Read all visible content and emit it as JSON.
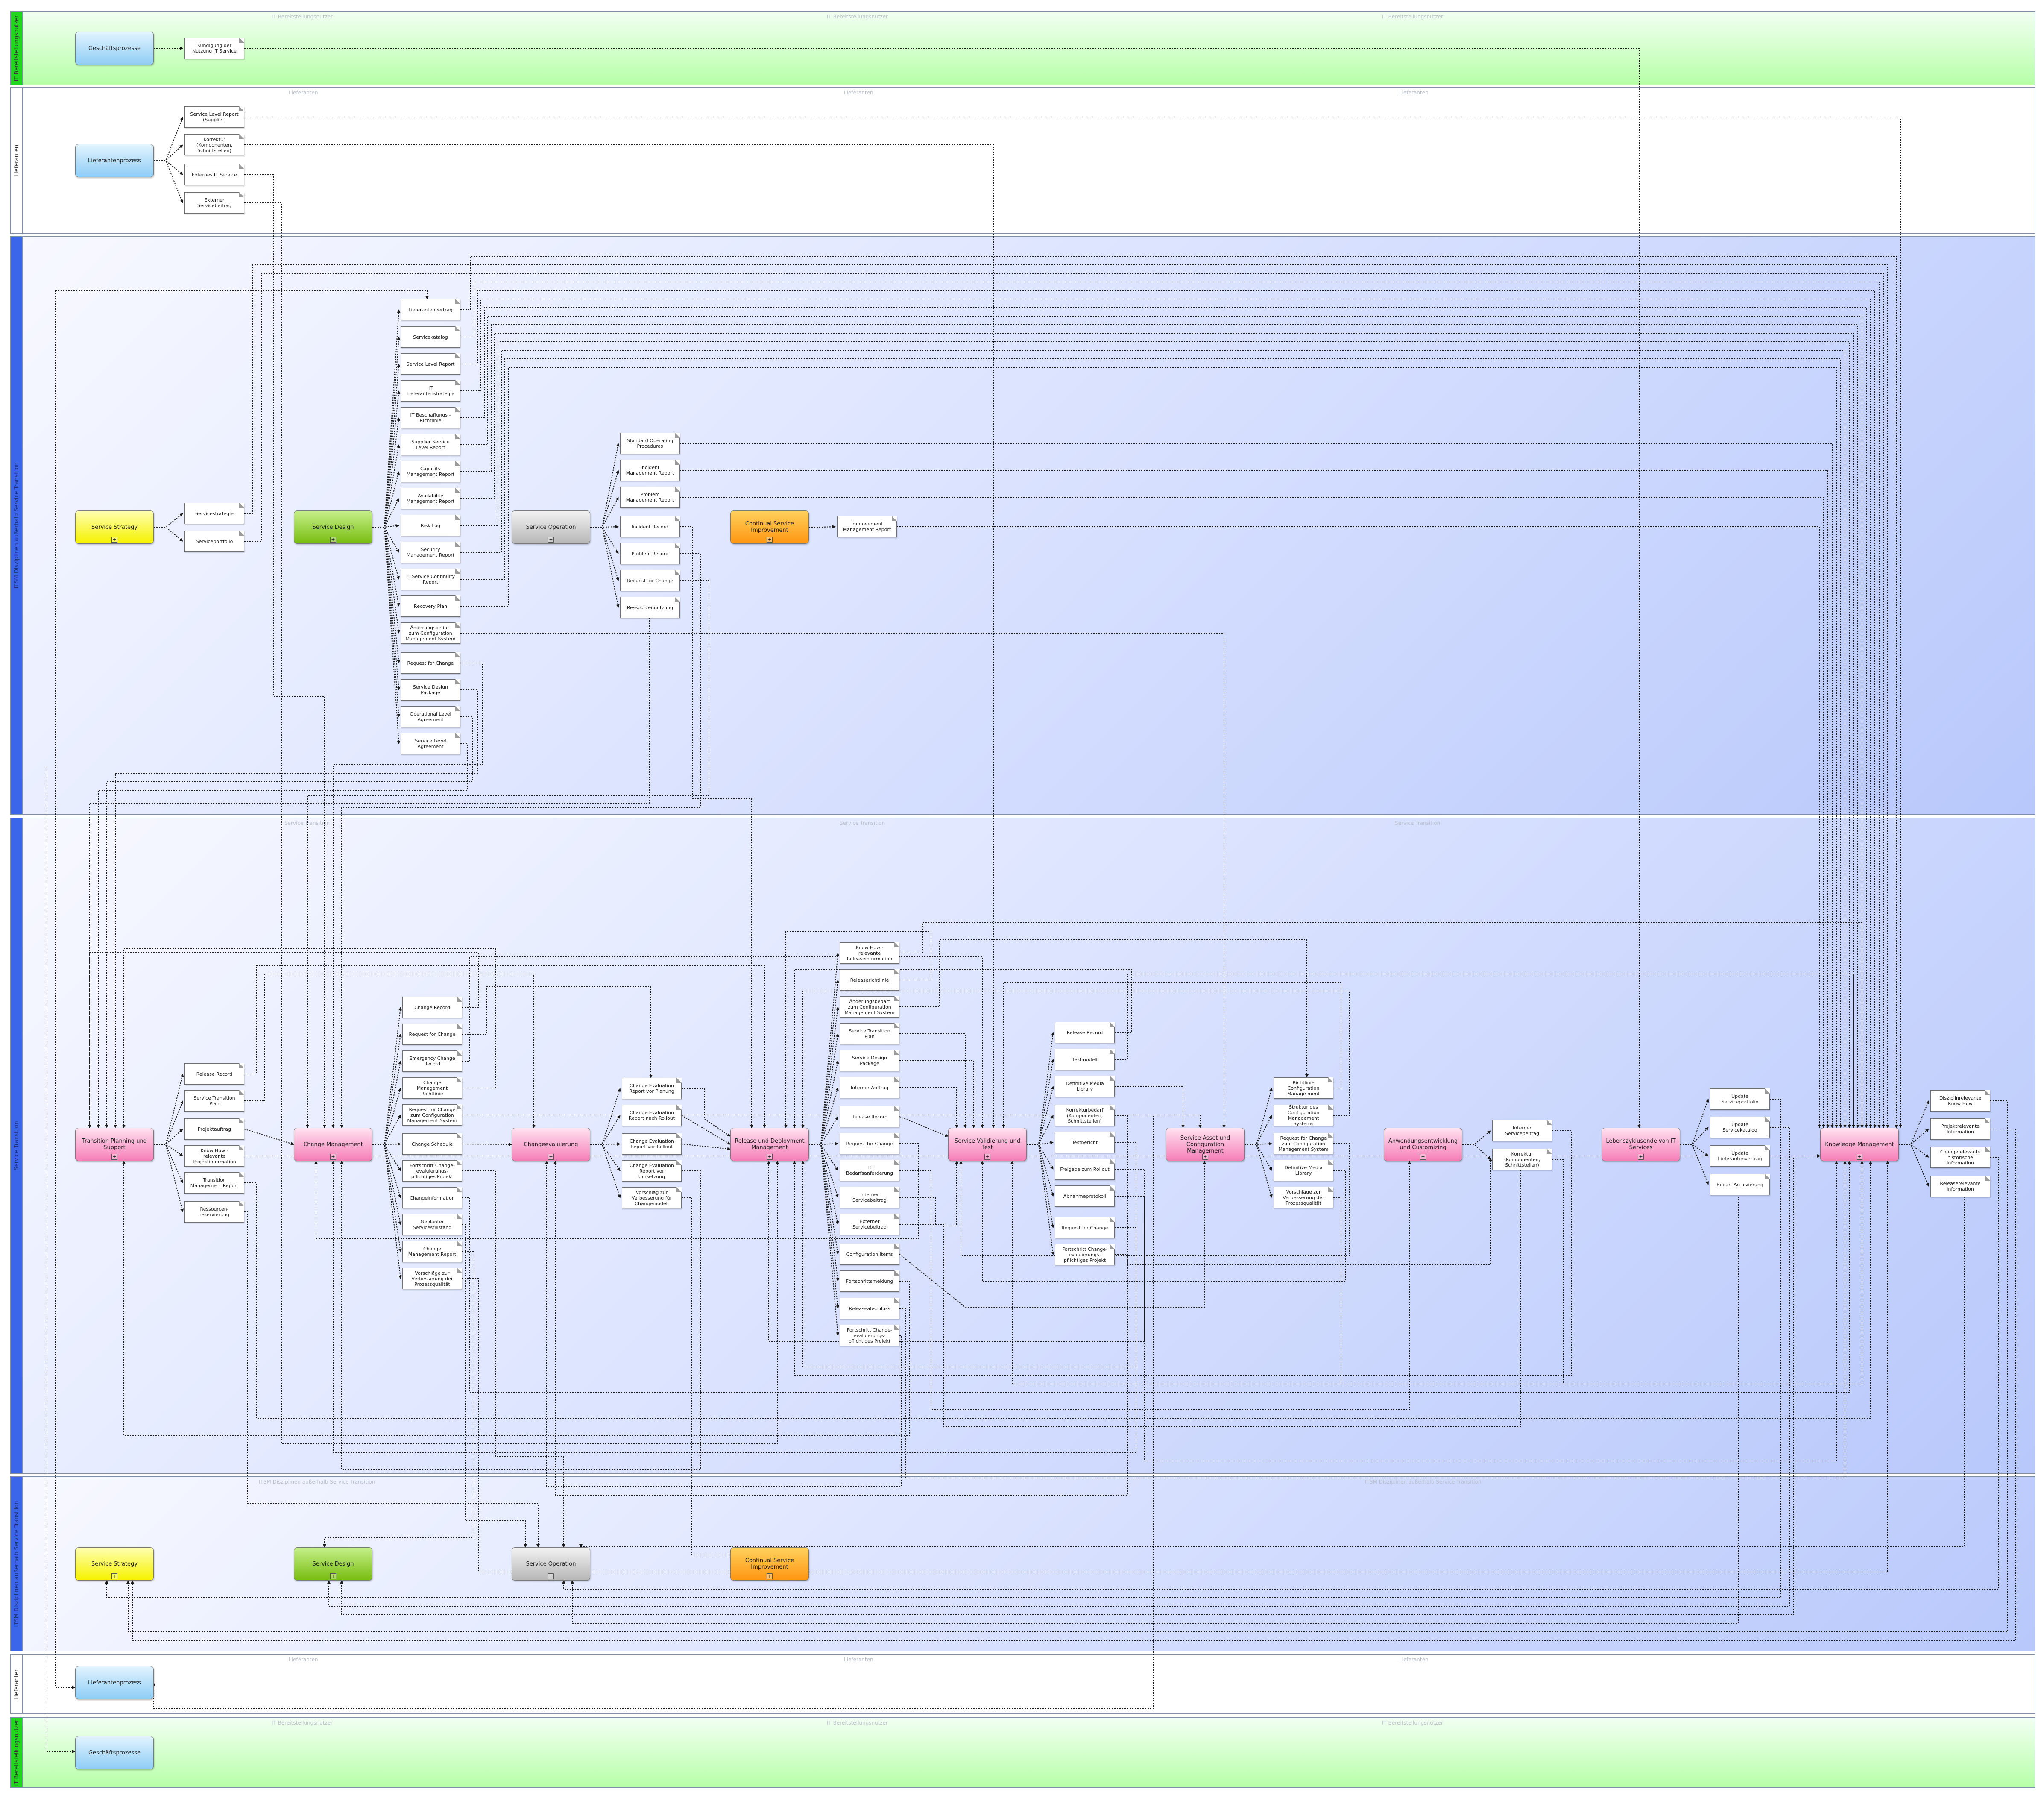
{
  "lanes": {
    "top_green": "IT Bereitstellungsnutzer",
    "supplier_top": "Lieferanten",
    "itsm_top": "ITSM Disziplinen außerhalb Service Transition",
    "service_transition": "Service Transition",
    "itsm_bottom": "ITSM Disziplinen außerhalb Service Transition",
    "supplier_bottom": "Lieferanten",
    "bottom_green": "IT Bereitstellungsnutzer"
  },
  "processes": {
    "geschaeftsprozesse_top": "Geschäftsprozesse",
    "lieferantenprozess_top": "Lieferantenprozess",
    "service_strategy_top": "Service Strategy",
    "service_design_top": "Service Design",
    "service_operation_top": "Service Operation",
    "csi_top": "Continual Service Improvement",
    "transition_planning": "Transition Planning und Support",
    "change_management": "Change Management",
    "changeevaluierung": "Changeevaluierung",
    "release_deployment": "Release und Deployment Management",
    "service_validierung": "Service Validierung und Test",
    "service_asset": "Service Asset und Configuration Management",
    "anwendungsentwicklung": "Anwendungsentwicklung und Customizing",
    "lebenszyklus": "Lebenszyklusende von IT Services",
    "knowledge_management": "Knowledge Management",
    "service_strategy_bottom": "Service Strategy",
    "service_design_bottom": "Service Design",
    "service_operation_bottom": "Service Operation",
    "csi_bottom": "Continual Service Improvement",
    "lieferantenprozess_bottom": "Lieferantenprozess",
    "geschaeftsprozesse_bottom": "Geschäftsprozesse"
  },
  "docs": {
    "kuendigung": "Kündigung der Nutzung IT Service",
    "sl_report_supplier": "Service Level Report (Supplier)",
    "korrektur_supplier": "Korrektur (Komponenten, Schnittstellen)",
    "externer_it_service": "Externes IT Service",
    "externer_servicebeitrag": "Externer Servicebeitrag",
    "servicestrategie": "Servicestrategie",
    "serviceportfolio": "Serviceportfolio",
    "lieferantenvertrag": "Lieferantenvertrag",
    "servicekatalog": "Servicekatalog",
    "service_level_report": "Service Level Report",
    "it_lieferantenstrategie": "IT Lieferantenstrategie",
    "it_beschaffungsrichtlinie": "IT Beschaffungs - Richtlinie",
    "supplier_sl_report": "Supplier Service Level Report",
    "capacity_report": "Capacity Management Report",
    "availability_report": "Availability Management Report",
    "risk_log": "Risk Log",
    "security_report": "Security Management Report",
    "it_service_continuity": "IT Service Continuity Report",
    "recovery_plan": "Recovery Plan",
    "aenderungsbedarf_cms_sd": "Änderungsbedarf zum Configuration Management System",
    "rfc_sd": "Request for Change",
    "sdp_sd": "Service Design Package",
    "ola": "Operational Level Agreement",
    "sla": "Service Level Agreement",
    "sop": "Standard Operating Procedures",
    "incident_mgmt_report": "Incident Management Report",
    "problem_mgmt_report": "Problem Management Report",
    "incident_record": "Incident Record",
    "problem_record": "Problem Record",
    "rfc_so": "Request for Change",
    "ressourcennutzung": "Ressourcennutzung",
    "improvement_report": "Improvement Management Report",
    "release_record_tp": "Release Record",
    "stp_tp": "Service Transition Plan",
    "projektauftrag": "Projektauftrag",
    "know_how_tp": "Know How - relevante Projektinformation",
    "transition_mgmt_report": "Transition Management Report",
    "ressourcenreservierung": "Ressourcen-reservierung",
    "change_record": "Change Record",
    "rfc_cm": "Request for Change",
    "emergency_change": "Emergency Change Record",
    "cm_richtlinie": "Change Management Richtlinie",
    "rfc_cms": "Request for Change zum Configuration Management System",
    "change_schedule": "Change Schedule",
    "fortschritt_change_cm": "Fortschritt Change-evaluierungs-pflichtiges Projekt",
    "changeinformation": "Changeinformation",
    "geplanter_servicestillstand": "Geplanter Servicestillstand",
    "cm_report": "Change Management Report",
    "vorschlaege_cm": "Vorschläge zur Verbesserung der Prozessqualität",
    "cer_planung": "Change Evaluation Report vor Planung",
    "cer_nach_rollout": "Change Evaluation Report nach Rollout",
    "cer_vor_rollout": "Change Evaluation Report vor Rollout",
    "cer_vor_umsetzung": "Change Evaluation Report vor Umsetzung",
    "vorschlag_verbesserung_changemodell": "Vorschlag zur Verbesserung für Changemodell",
    "know_how_release": "Know How - relevante Releaseinformation",
    "releaserichtlinie": "Releaserichtlinie",
    "aenderungsbedarf_cms_rd": "Änderungsbedarf zum Configuration Management System",
    "stp_rd": "Service Transition Plan",
    "sdp_rd": "Service Design Package",
    "interner_auftrag": "Interner Auftrag",
    "release_record_rd": "Release Record",
    "rfc_rd": "Request for Change",
    "it_bedarfsanforderung": "IT Bedarfsanforderung",
    "interner_servicebeitrag_rd": "Interner Servicebeitrag",
    "externer_servicebeitrag_rd": "Externer Servicebeitrag",
    "configuration_items": "Configuration Items",
    "fortschrittsmeldung": "Fortschrittsmeldung",
    "releaseabschluss": "Releaseabschluss",
    "fortschritt_change_rd": "Fortschritt Change-evaluierungs-pflichtiges Projekt",
    "release_record_sv": "Release Record",
    "testmodell": "Testmodell",
    "dml_sv": "Definitive Media Library",
    "korrekturbedarf": "Korrekturbedarf (Komponenten, Schnittstellen)",
    "testbericht": "Testbericht",
    "freigabe_rollout": "Freigabe zum Rollout",
    "abnahmeprotokoll": "Abnahmeprotokoll",
    "rfc_sv": "Request for Change",
    "fortschritt_change_sv": "Fortschritt Change-evaluierungs-pflichtiges Projekt",
    "richtlinie_cm": "Richtlinie Configuration Manage ment",
    "struktur_cms": "Struktur des Configuration Management Systems",
    "rfc_cms_sa": "Request for Change zum Configuration Management System",
    "dml_sa": "Definitive Media Library",
    "vorschlaege_sa": "Vorschläge zur Verbesserung der Prozessqualität",
    "interner_servicebeitrag": "Interner Servicebeitrag",
    "korrektur_komponenten": "Korrektur (Komponenten, Schnittstellen)",
    "update_serviceportfolio": "Update Serviceportfolio",
    "update_servicekatalog": "Update Servicekatalog",
    "update_lieferantenvertrag": "Update Lieferantenvertrag",
    "bedarf_archivierung": "Bedarf Archivierung",
    "disziplinrelevante": "Disziplinrelevante Know How",
    "projektrelevante": "Projektrelevante Information",
    "changerelevante": "Changerelevante historische Information",
    "releaserelevante": "Releaserelevante Information"
  },
  "colors": {
    "connector": "#1a1a1a",
    "lane_green": "#b7ffa8",
    "lane_blue": "#b8c8fb",
    "tab_blue": "#3b66ea",
    "tab_green": "#22d81e"
  }
}
